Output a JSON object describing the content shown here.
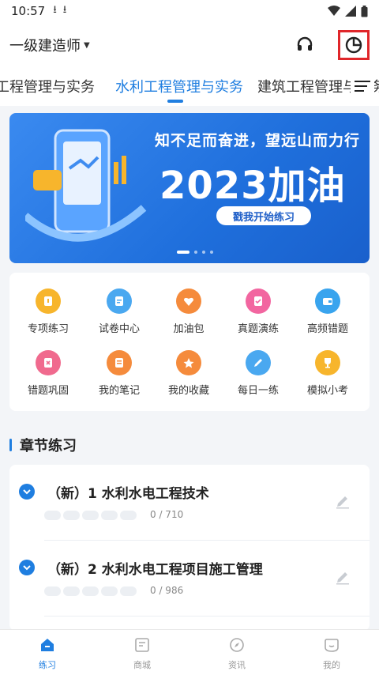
{
  "status_bar": {
    "time": "10:57"
  },
  "header": {
    "exam_title": "一级建造师"
  },
  "tabs": [
    {
      "label": "工程管理与实务"
    },
    {
      "label": "水利工程管理与实务"
    },
    {
      "label": "建筑工程管理与实务"
    }
  ],
  "banner": {
    "slogan": "知不足而奋进，望远山而力行",
    "headline": "2023加油",
    "cta": "戳我开始练习"
  },
  "quick_grid": [
    {
      "label": "专项练习",
      "color": "#f7b52c",
      "icon": "target-icon"
    },
    {
      "label": "试卷中心",
      "color": "#4aa8f0",
      "icon": "paper-icon"
    },
    {
      "label": "加油包",
      "color": "#f58b3c",
      "icon": "heart-box-icon"
    },
    {
      "label": "真题演练",
      "color": "#f266a0",
      "icon": "exam-icon"
    },
    {
      "label": "高频错题",
      "color": "#39a4ee",
      "icon": "wallet-icon"
    },
    {
      "label": "错题巩固",
      "color": "#f06a8e",
      "icon": "wrong-icon"
    },
    {
      "label": "我的笔记",
      "color": "#f58b3c",
      "icon": "note-icon"
    },
    {
      "label": "我的收藏",
      "color": "#f58b3c",
      "icon": "star-icon"
    },
    {
      "label": "每日一练",
      "color": "#4aa8f0",
      "icon": "pen-icon"
    },
    {
      "label": "模拟小考",
      "color": "#f7b52c",
      "icon": "trophy-icon"
    }
  ],
  "section": {
    "title": "章节练习"
  },
  "chapters": [
    {
      "title": "（新）1 水利水电工程技术",
      "progress": "0 / 710"
    },
    {
      "title": "（新）2 水利水电工程项目施工管理",
      "progress": "0 / 986"
    }
  ],
  "bottom_nav": [
    {
      "label": "练习",
      "active": true
    },
    {
      "label": "商城",
      "active": false
    },
    {
      "label": "资讯",
      "active": false
    },
    {
      "label": "我的",
      "active": false
    }
  ]
}
